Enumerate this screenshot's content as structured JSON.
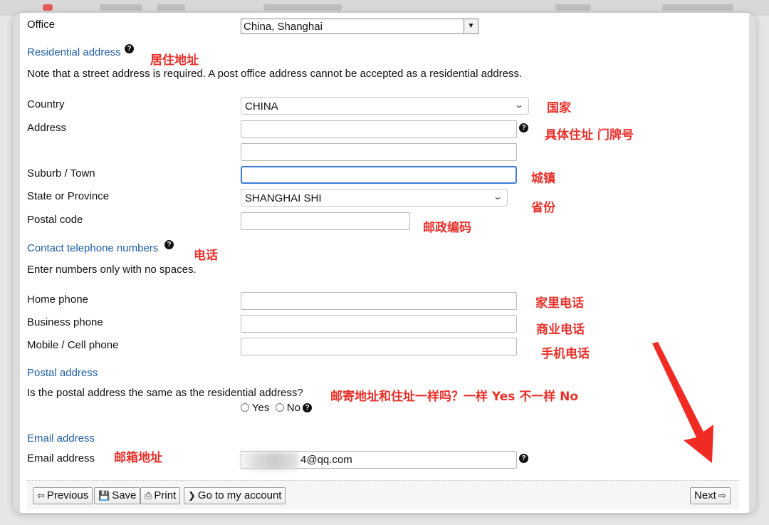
{
  "office": {
    "label": "Office",
    "value": "China, Shanghai"
  },
  "residential": {
    "heading": "Residential address",
    "heading_note": "居住地址",
    "note": "Note that a street address is required. A post office address cannot be accepted as a residential address.",
    "country": {
      "label": "Country",
      "value": "CHINA",
      "note": "国家"
    },
    "address": {
      "label": "Address",
      "line1": "",
      "line2": "",
      "note": "具体住址 门牌号"
    },
    "suburb": {
      "label": "Suburb / Town",
      "value": "",
      "note": "城镇"
    },
    "state": {
      "label": "State or Province",
      "value": "SHANGHAI SHI",
      "note": "省份"
    },
    "postal_code": {
      "label": "Postal code",
      "value": "",
      "note": "邮政编码"
    }
  },
  "contact": {
    "heading": "Contact telephone numbers",
    "heading_note": "电话",
    "note": "Enter numbers only with no spaces.",
    "home": {
      "label": "Home phone",
      "value": "",
      "note": "家里电话"
    },
    "business": {
      "label": "Business phone",
      "value": "",
      "note": "商业电话"
    },
    "mobile": {
      "label": "Mobile / Cell phone",
      "value": "",
      "note": "手机电话"
    }
  },
  "postal": {
    "heading": "Postal address",
    "question": "Is the postal address the same as the residential address?",
    "yes_label": "Yes",
    "no_label": "No",
    "note": "邮寄地址和住址一样吗？一样 Yes 不一样 No"
  },
  "email": {
    "heading": "Email address",
    "label": "Email address",
    "label_note": "邮箱地址",
    "value": "4@qq.com"
  },
  "footer": {
    "previous": "Previous",
    "save": "Save",
    "print": "Print",
    "account": "Go to my account",
    "next": "Next"
  },
  "colors": {
    "section": "#1f5fa5",
    "annotation": "#e8302a",
    "focus": "#3d7bd6"
  },
  "icons": [
    "help-icon",
    "chevron-down-icon",
    "arrow-left-icon",
    "save-icon",
    "print-icon",
    "chevron-right-icon",
    "arrow-right-icon",
    "red-pointer-arrow"
  ]
}
